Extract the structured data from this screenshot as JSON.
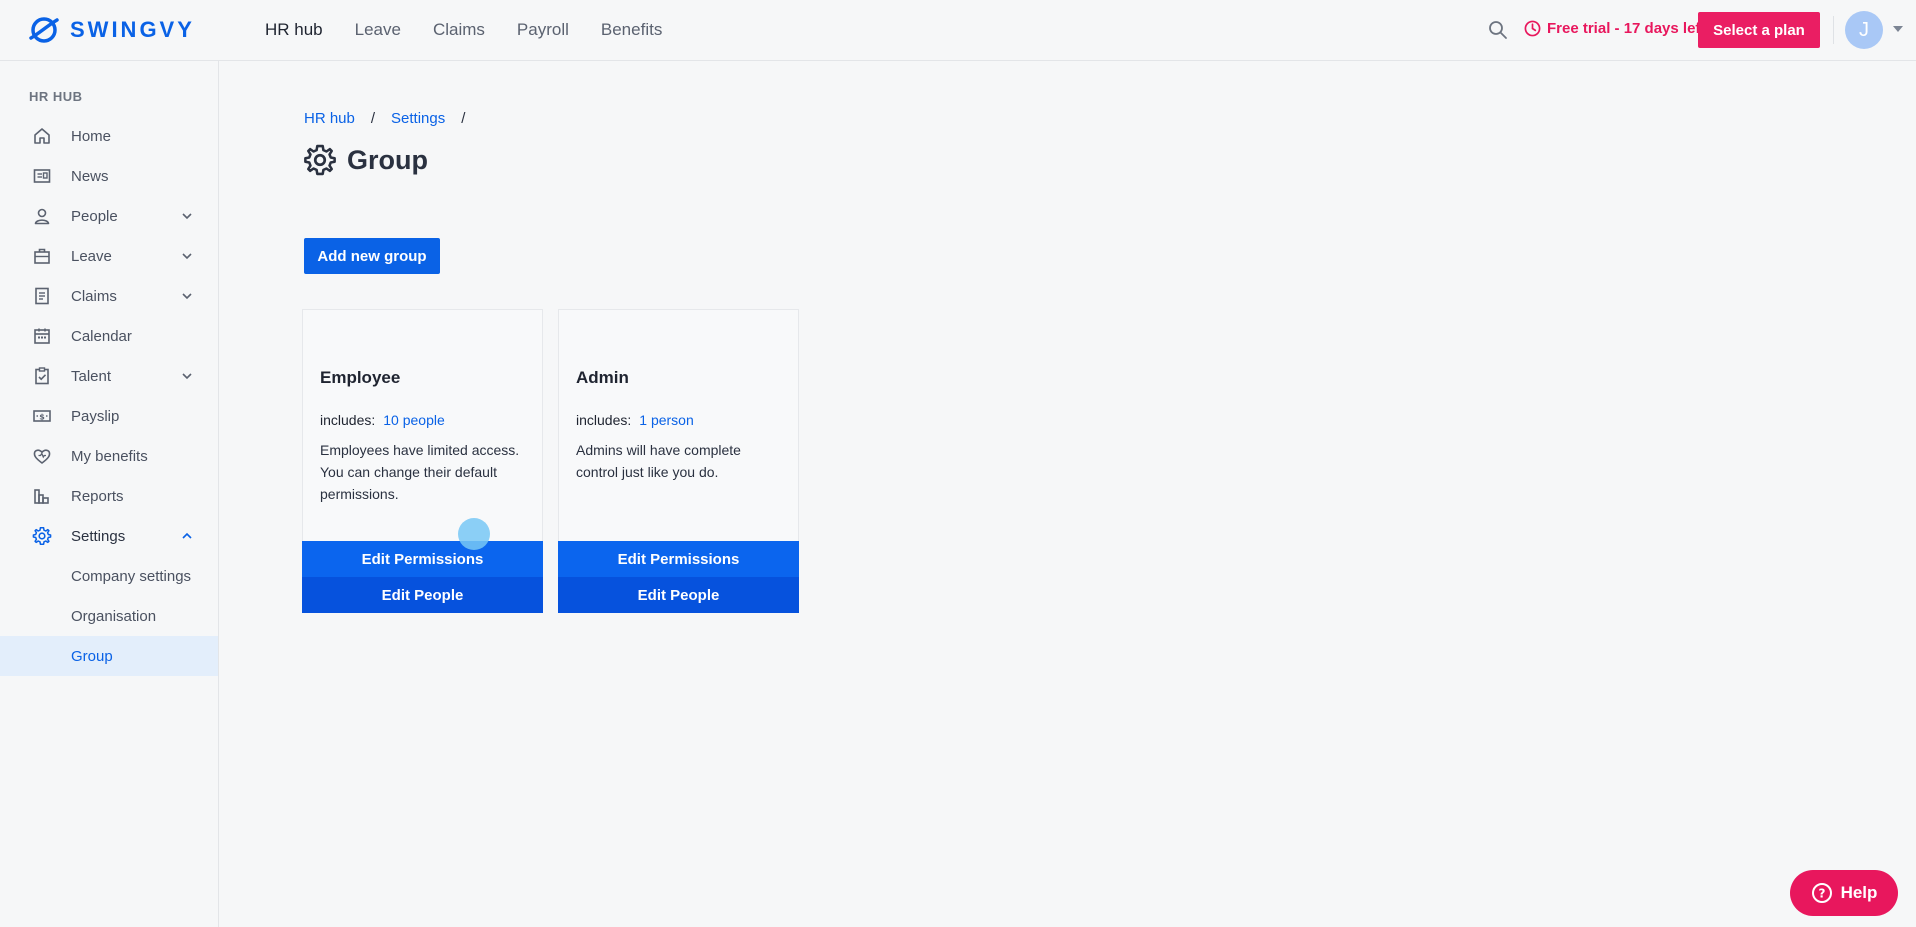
{
  "brand": {
    "name": "SWINGVY",
    "color": "#0a62e6"
  },
  "topnav": {
    "items": [
      {
        "label": "HR hub",
        "active": true
      },
      {
        "label": "Leave",
        "active": false
      },
      {
        "label": "Claims",
        "active": false
      },
      {
        "label": "Payroll",
        "active": false
      },
      {
        "label": "Benefits",
        "active": false
      }
    ],
    "trial_text": "Free trial - 17 days left",
    "select_plan_label": "Select a plan",
    "avatar_initial": "J"
  },
  "sidebar": {
    "heading": "HR HUB",
    "items": [
      {
        "label": "Home",
        "icon": "home-icon"
      },
      {
        "label": "News",
        "icon": "news-icon"
      },
      {
        "label": "People",
        "icon": "person-icon",
        "expandable": true
      },
      {
        "label": "Leave",
        "icon": "briefcase-icon",
        "expandable": true
      },
      {
        "label": "Claims",
        "icon": "receipt-icon",
        "expandable": true
      },
      {
        "label": "Calendar",
        "icon": "calendar-icon"
      },
      {
        "label": "Talent",
        "icon": "clipboard-check-icon",
        "expandable": true
      },
      {
        "label": "Payslip",
        "icon": "payslip-icon"
      },
      {
        "label": "My benefits",
        "icon": "heart-icon"
      },
      {
        "label": "Reports",
        "icon": "bar-chart-icon"
      },
      {
        "label": "Settings",
        "icon": "gear-icon",
        "expanded": true
      }
    ],
    "sub_items": [
      {
        "label": "Company settings",
        "selected": false
      },
      {
        "label": "Organisation",
        "selected": false
      },
      {
        "label": "Group",
        "selected": true
      }
    ]
  },
  "breadcrumb": {
    "items": [
      "HR hub",
      "Settings"
    ],
    "separator": "/"
  },
  "page": {
    "title": "Group",
    "add_button_label": "Add new group"
  },
  "groups": [
    {
      "name": "Employee",
      "includes_label": "includes:",
      "includes_link": "10 people",
      "description": "Employees have limited access. You can change their default permissions.",
      "edit_permissions_label": "Edit Permissions",
      "edit_people_label": "Edit People"
    },
    {
      "name": "Admin",
      "includes_label": "includes:",
      "includes_link": "1 person",
      "description": "Admins will have complete control just like you do.",
      "edit_permissions_label": "Edit Permissions",
      "edit_people_label": "Edit People"
    }
  ],
  "help_label": "Help",
  "colors": {
    "primary": "#0a62e6",
    "accent": "#e8175d"
  }
}
